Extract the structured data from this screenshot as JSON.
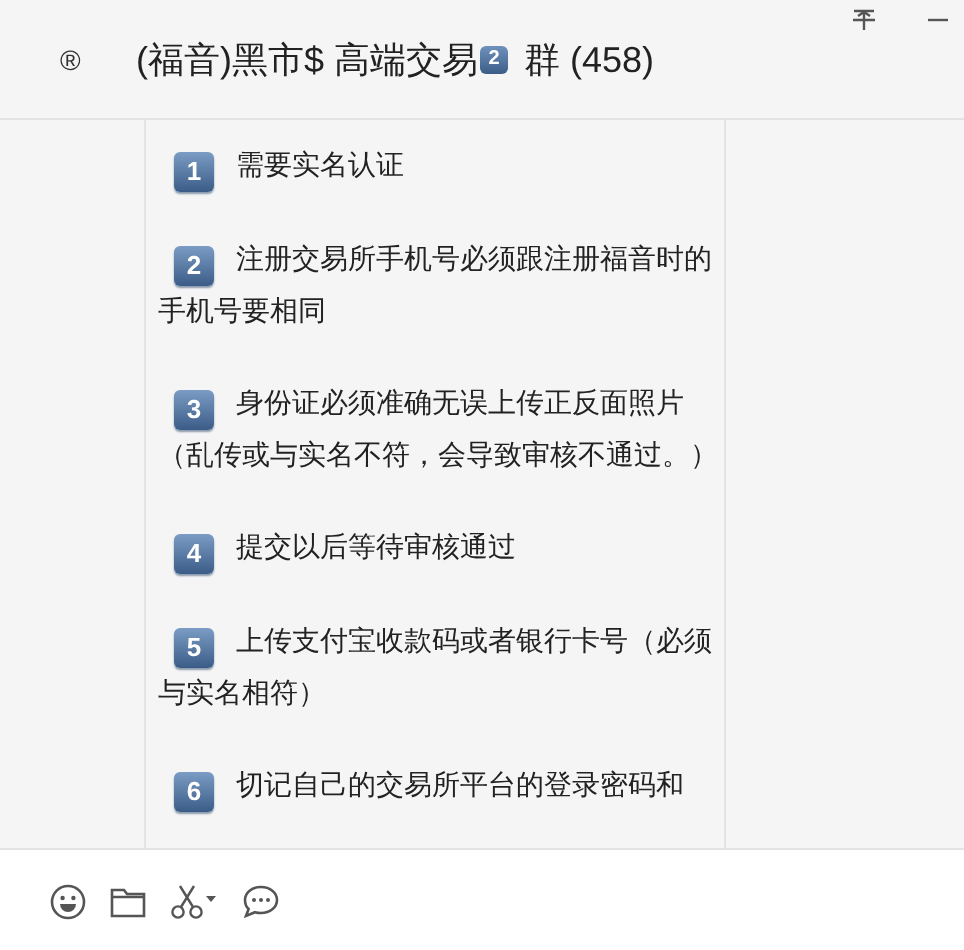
{
  "header": {
    "mark": "®",
    "title": "(福音)黑市$ 高端交易",
    "title_badge": "2",
    "title_suffix": "群 (458)"
  },
  "steps": [
    {
      "number": "1",
      "text": "需要实名认证"
    },
    {
      "number": "2",
      "text": "注册交易所手机号必须跟注册福音时的手机号要相同"
    },
    {
      "number": "3",
      "text": "身份证必须准确无误上传正反面照片（乱传或与实名不符，会导致审核不通过。）"
    },
    {
      "number": "4",
      "text": "提交以后等待审核通过"
    },
    {
      "number": "5",
      "text": "上传支付宝收款码或者银行卡号（必须与实名相符）"
    },
    {
      "number": "6",
      "text": "切记自己的交易所平台的登录密码和"
    }
  ]
}
